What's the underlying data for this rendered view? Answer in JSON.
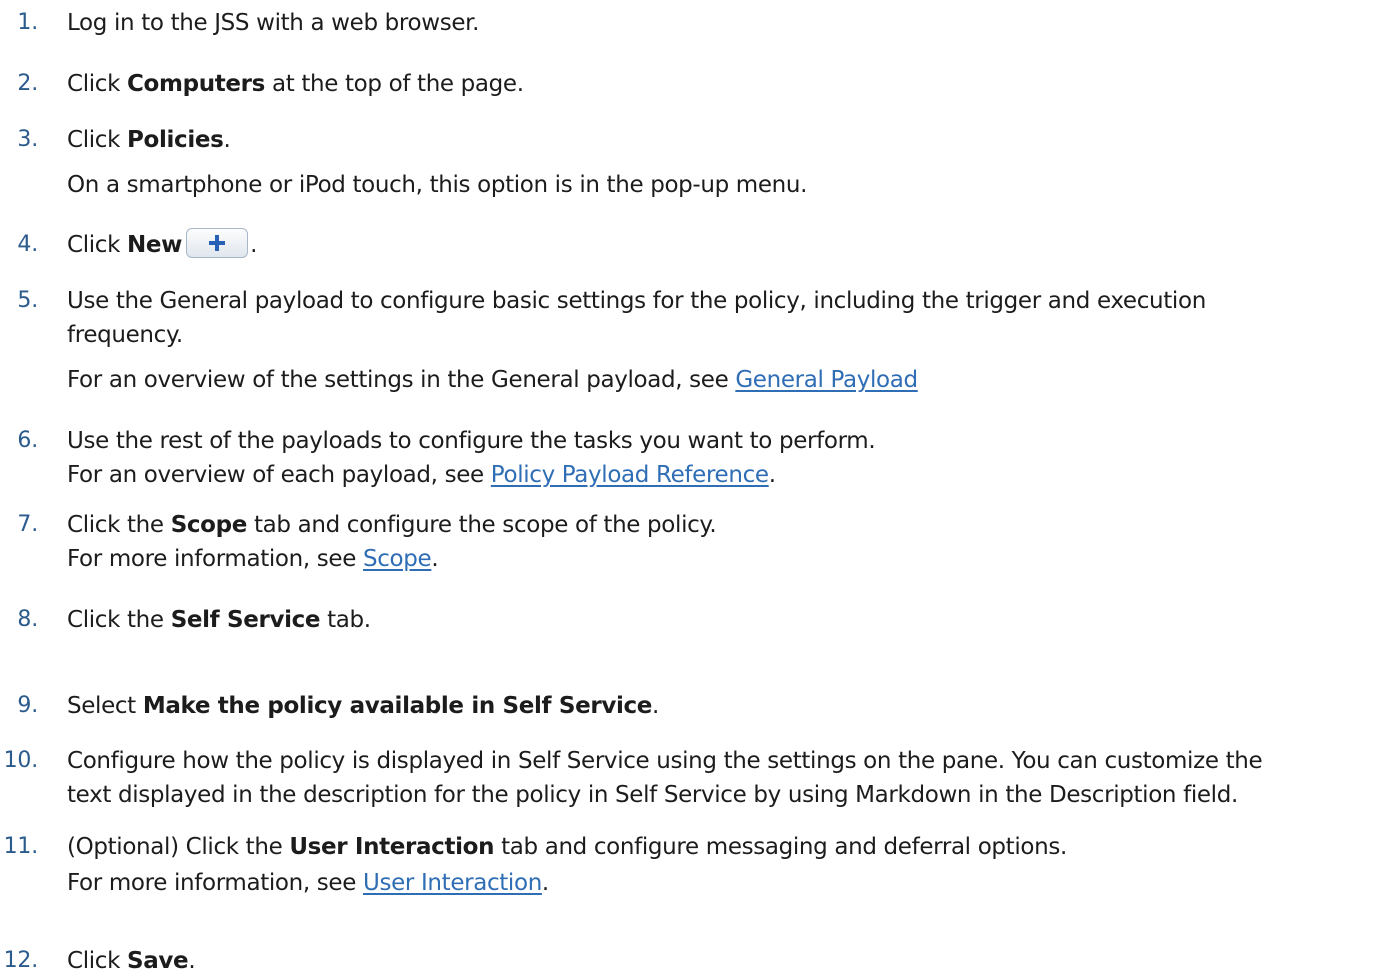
{
  "steps": [
    {
      "number": "1.",
      "text_parts": [
        "Log in to the JSS with a web browser."
      ]
    },
    {
      "number": "2.",
      "pre": "Click ",
      "bold": "Computers",
      "post": " at the top of the page."
    },
    {
      "number": "3.",
      "pre": "Click ",
      "bold": "Policies",
      "post": ".",
      "sub": "On a smartphone or iPod touch, this option is in the pop-up menu."
    },
    {
      "number": "4.",
      "pre": "Click ",
      "bold": "New",
      "post": ".",
      "icon": "plus-icon"
    },
    {
      "number": "5.",
      "line1": "Use the General payload to configure basic settings for the policy, including the trigger and execution",
      "line2": "frequency.",
      "sub_pre": "For an overview of the settings in the General payload, see ",
      "link": "General Payload"
    },
    {
      "number": "6.",
      "text": "Use the rest of the payloads to configure the tasks you want to perform.",
      "sub_pre": "For an overview of each payload, see ",
      "link": "Policy Payload Reference",
      "sub_post": "."
    },
    {
      "number": "7.",
      "pre": "Click the ",
      "bold": "Scope",
      "post": " tab and configure the scope of the policy.",
      "sub_pre": "For more information, see ",
      "link": "Scope",
      "sub_post": "."
    },
    {
      "number": "8.",
      "pre": "Click the ",
      "bold": "Self Service",
      "post": " tab."
    },
    {
      "number": "9.",
      "pre": "Select ",
      "bold": "Make the policy available in Self Service",
      "post": "."
    },
    {
      "number": "10.",
      "line1": "Configure how the policy is displayed in Self Service using the settings on the pane. You can customize the",
      "line2": "text displayed in the description for the policy in Self Service by using Markdown in the Description field."
    },
    {
      "number": "11.",
      "pre": "(Optional) Click the ",
      "bold": "User Interaction",
      "post": " tab and configure messaging and deferral options.",
      "sub_pre": "For more information, see ",
      "link": "User Interaction",
      "sub_post": "."
    },
    {
      "number": "12.",
      "pre": "Click ",
      "bold": "Save",
      "post": "."
    }
  ]
}
